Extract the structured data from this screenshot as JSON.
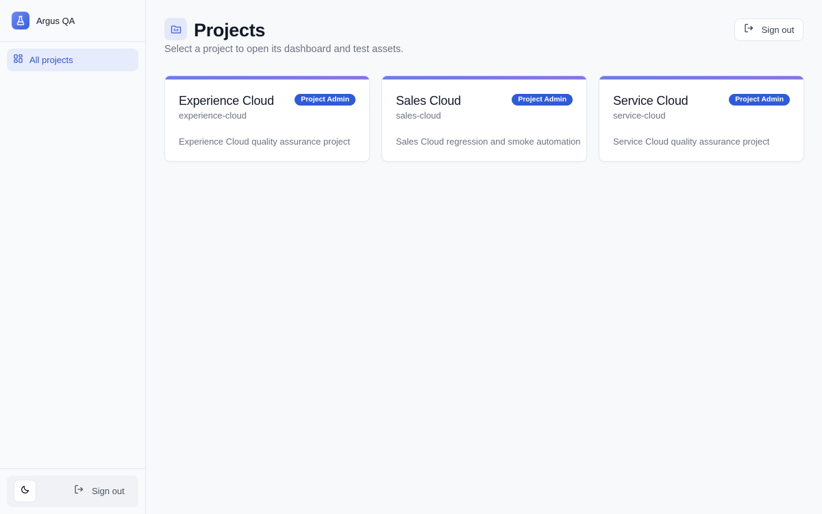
{
  "app": {
    "name": "Argus QA",
    "logo_icon": "flask-icon"
  },
  "sidebar": {
    "nav": [
      {
        "label": "All projects",
        "icon": "grid-icon"
      }
    ],
    "footer": {
      "theme_icon": "moon-icon",
      "signout_label": "Sign out"
    }
  },
  "header": {
    "title": "Projects",
    "subtitle": "Select a project to open its dashboard and test assets.",
    "signout_label": "Sign out"
  },
  "projects": [
    {
      "name": "Experience Cloud",
      "slug": "experience-cloud",
      "role": "Project Admin",
      "description": "Experience Cloud quality assurance project"
    },
    {
      "name": "Sales Cloud",
      "slug": "sales-cloud",
      "role": "Project Admin",
      "description": "Sales Cloud regression and smoke automation"
    },
    {
      "name": "Service Cloud",
      "slug": "service-cloud",
      "role": "Project Admin",
      "description": "Service Cloud quality assurance project"
    }
  ],
  "colors": {
    "accent": "#2f5bd6",
    "nav_active_bg": "#e6ecfb",
    "card_accent_start": "#6b7ee8",
    "card_accent_end": "#8a74e8"
  }
}
